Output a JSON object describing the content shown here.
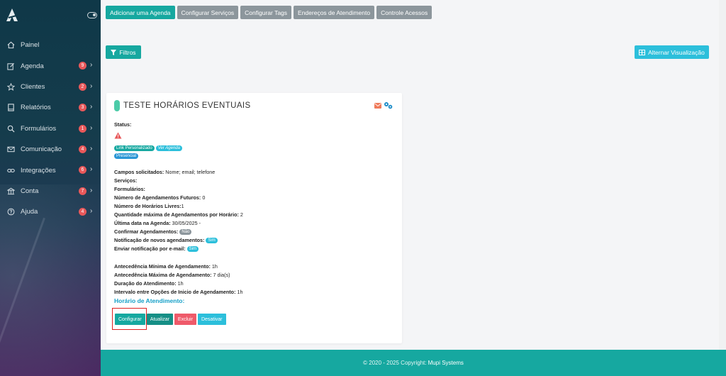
{
  "sidebar": {
    "items": [
      {
        "label": "Painel",
        "icon": "home-icon",
        "badge": ""
      },
      {
        "label": "Agenda",
        "icon": "edit-icon",
        "badge": "9"
      },
      {
        "label": "Clientes",
        "icon": "star-icon",
        "badge": "2"
      },
      {
        "label": "Relatórios",
        "icon": "book-icon",
        "badge": "3"
      },
      {
        "label": "Formulários",
        "icon": "search-icon",
        "badge": "1"
      },
      {
        "label": "Comunicação",
        "icon": "mail-icon",
        "badge": "4"
      },
      {
        "label": "Integrações",
        "icon": "link-icon",
        "badge": "6"
      },
      {
        "label": "Conta",
        "icon": "bank-icon",
        "badge": "7"
      },
      {
        "label": "Ajuda",
        "icon": "help-icon",
        "badge": "4"
      }
    ],
    "chevron": "›"
  },
  "topbar": {
    "buttons": [
      "Adicionar uma Agenda",
      "Configurar Serviços",
      "Configurar Tags",
      "Endereços de Atendimento",
      "Controle Acessos"
    ]
  },
  "filters_label": "Filtros",
  "toggle_view_label": "Alternar Visualização",
  "card": {
    "title": "TESTE HORÁRIOS EVENTUAIS",
    "status_label": "Status:",
    "pills": {
      "link": "Link Personalizado",
      "view": "Ver Agenda",
      "presencial": "Presencial"
    },
    "fields": {
      "campos": {
        "label": "Campos solicitados:",
        "value": " Nome; email; telefone"
      },
      "servicos": {
        "label": "Serviços:",
        "value": ""
      },
      "formularios": {
        "label": "Formulários:",
        "value": ""
      },
      "futuros": {
        "label": "Número de Agendamentos Futuros:",
        "value": " 0"
      },
      "livres": {
        "label": "Número de Horários Livres:",
        "value": "1"
      },
      "maxima": {
        "label": "Quantidade máxima de Agendamentos por Horário:",
        "value": " 2"
      },
      "ultima": {
        "label": "Última data na Agenda:",
        "value": " 30/05/2025 -"
      },
      "confirmar": {
        "label": "Confirmar Agendamentos:",
        "badge": "Não"
      },
      "notificacao": {
        "label": "Notificação de novos agendamentos:",
        "badge": "Sim"
      },
      "email": {
        "label": "Enviar notificação por e-mail:",
        "badge": "Sim"
      },
      "ant_min": {
        "label": "Antecedência Mínima de Agendamento:",
        "value": " 1h"
      },
      "ant_max": {
        "label": "Antecedência Máxima de Agendamento:",
        "value": " 7 dia(s)"
      },
      "duracao": {
        "label": "Duração do Atendimento:",
        "value": " 1h"
      },
      "intervalo": {
        "label": "Intervalo entre Opções de Inicio de Agendamento:",
        "value": " 1h"
      }
    },
    "section_title": "Horário de Atendimento:",
    "actions": {
      "configurar": "Configurar",
      "atualizar": "Atualizar",
      "excluir": "Excluir",
      "desativar": "Desativar"
    }
  },
  "footer": {
    "text": "© 2020 - 2025 Copyright:",
    "link": "Mupi Systems"
  },
  "colors": {
    "accent": "#16a8a0",
    "info": "#2cbfdb",
    "danger": "#ef5a6a",
    "muted": "#8c969c"
  }
}
